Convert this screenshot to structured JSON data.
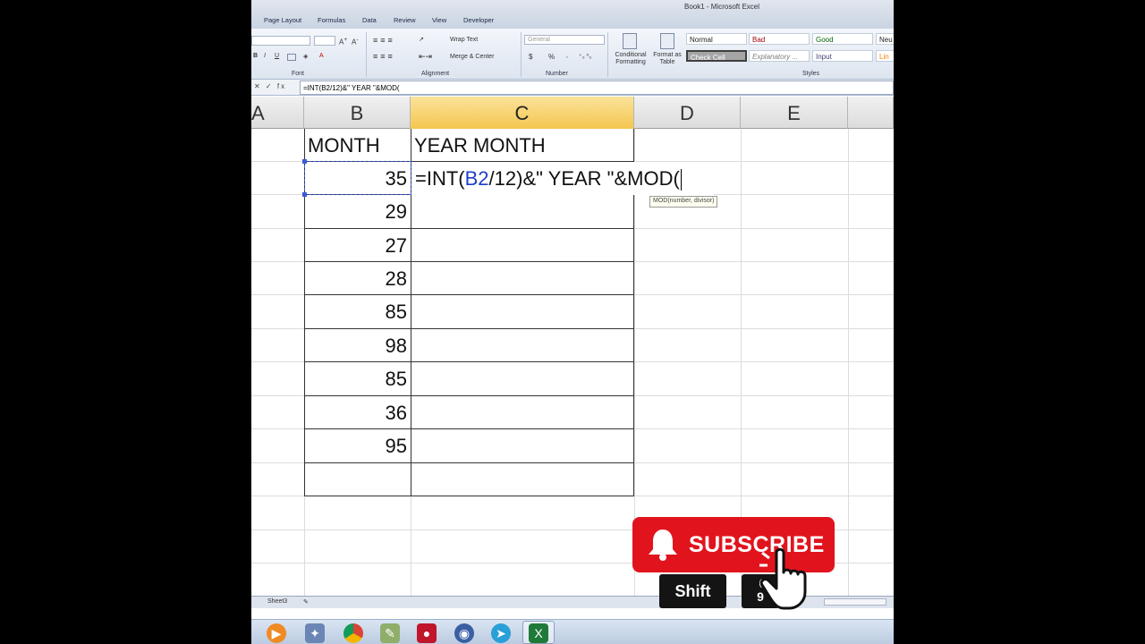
{
  "window": {
    "title": "Book1 - Microsoft Excel"
  },
  "ribbon_tabs": [
    "Page Layout",
    "Formulas",
    "Data",
    "Review",
    "View",
    "Developer"
  ],
  "ribbon": {
    "wrap_text": "Wrap Text",
    "merge_center": "Merge & Center",
    "number_format": "General",
    "currency_symbol": "$",
    "percent_symbol": "%",
    "conditional_formatting": "Conditional Formatting",
    "format_as_table": "Format as Table",
    "groups": {
      "font": "Font",
      "alignment": "Alignment",
      "number": "Number",
      "styles": "Styles"
    },
    "styles": {
      "normal": "Normal",
      "bad": "Bad",
      "good": "Good",
      "neutral": "Neu",
      "check_cell": "Check Cell",
      "explanatory": "Explanatory ...",
      "input": "Input",
      "linked": "Lin"
    }
  },
  "formula_bar": {
    "icons": "✕ ✓ fx",
    "value": "=INT(B2/12)&\" YEAR \"&MOD("
  },
  "columns": [
    "A",
    "B",
    "C",
    "D",
    "E"
  ],
  "active_column": "C",
  "sheet": {
    "header_b": "MONTH",
    "header_c": "YEAR MONTH",
    "months": [
      "35",
      "29",
      "27",
      "28",
      "85",
      "98",
      "85",
      "36",
      "95"
    ],
    "editing": {
      "prefix": "=INT(",
      "ref": "B2",
      "suffix": "/12)&\" YEAR \"&MOD("
    },
    "tooltip": "MOD(number, divisor)"
  },
  "sheet_tabs": {
    "sheet3": "Sheet3"
  },
  "overlay": {
    "subscribe": "SUBSCRIBE",
    "key_shift": "Shift",
    "key_nine_top": "(",
    "key_nine": "9"
  },
  "colors": {
    "accent_red": "#e1141d",
    "reference_blue": "#1f3ec9",
    "active_header": "#f4c651"
  }
}
